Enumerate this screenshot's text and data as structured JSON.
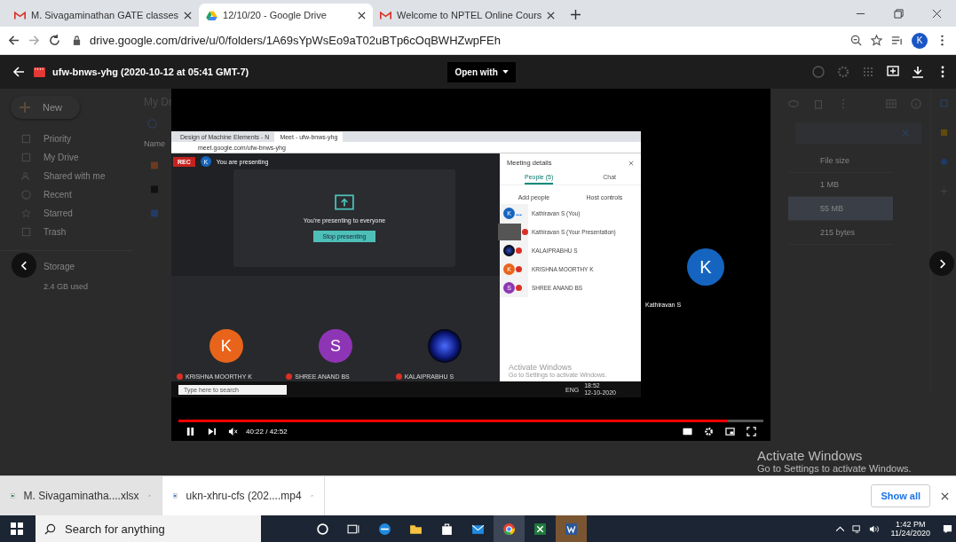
{
  "browser": {
    "tabs": [
      {
        "title": "M. Sivagaminathan GATE classes",
        "kind": "gmail",
        "selected": false
      },
      {
        "title": "12/10/20 - Google Drive",
        "kind": "drive",
        "selected": true
      },
      {
        "title": "Welcome to NPTEL Online Cours",
        "kind": "gmail",
        "selected": false
      }
    ],
    "url": "drive.google.com/drive/u/0/folders/1A69sYpWsEo9aT02uBTp6cOqBWHZwpFEh",
    "profile_initial": "K"
  },
  "viewer": {
    "file_name": "ufw-bnws-yhg (2020-10-12 at 05:41 GMT-7)",
    "open_with": "Open with"
  },
  "drive": {
    "new_button": "New",
    "nav": [
      {
        "label": "Priority",
        "kind": "priority"
      },
      {
        "label": "My Drive",
        "kind": "drive"
      },
      {
        "label": "Shared with me",
        "kind": "shared"
      },
      {
        "label": "Recent",
        "kind": "recent"
      },
      {
        "label": "Starred",
        "kind": "starred"
      },
      {
        "label": "Trash",
        "kind": "trash"
      }
    ],
    "storage_label": "Storage",
    "storage_used": "2.4 GB used",
    "breadcrumb": "My Dr",
    "name_header": "Name",
    "size_header": "File size",
    "files": [
      {
        "size": "1 MB",
        "kind": "slides",
        "selected": false
      },
      {
        "size": "55 MB",
        "kind": "video",
        "selected": true
      },
      {
        "size": "215 bytes",
        "kind": "doc",
        "selected": false
      }
    ]
  },
  "video": {
    "level": 0.94,
    "time": "40:22 / 42:52",
    "speaker": {
      "initial": "K",
      "name": "Kathiravan S",
      "color": "#1565c0"
    },
    "recording": {
      "tabs": [
        {
          "title": "Design of Machine Elements - N",
          "selected": false
        },
        {
          "title": "Meet - ufw-bnws-yhg",
          "selected": true
        }
      ],
      "url": "meet.google.com/ufw-bnws-yhg",
      "rec": "REC",
      "presenter_initial": "K",
      "status": "You are presenting",
      "message": "You're presenting to everyone",
      "stop": "Stop presenting",
      "tiles": [
        {
          "initial": "K",
          "kind": "avatar",
          "color": "#e8641b",
          "name": "KRISHNA MOORTHY K"
        },
        {
          "initial": "S",
          "kind": "avatar",
          "color": "#8e35b5",
          "name": "SHREE ANAND BS"
        },
        {
          "kind": "photo",
          "name": "KALAIPRABHU S"
        }
      ],
      "search": "Type here to search",
      "tray_lang": "ENG",
      "tray_time": "18:52",
      "tray_date": "12-10-2020",
      "panel": {
        "title": "Meeting details",
        "tabs": [
          {
            "label": "People (5)",
            "selected": true
          },
          {
            "label": "Chat",
            "selected": false
          }
        ],
        "actions": [
          "Add people",
          "Host controls"
        ],
        "people": [
          {
            "name": "Kathiravan S (You)",
            "kind": "avatar",
            "initial": "K",
            "color": "#1565c0",
            "muted": false
          },
          {
            "name": "Kathiravan S (Your Presentation)",
            "kind": "screen",
            "muted": true
          },
          {
            "name": "KALAIPRABHU S",
            "kind": "photo",
            "muted": true
          },
          {
            "name": "KRISHNA MOORTHY K",
            "kind": "avatar",
            "initial": "K",
            "color": "#e8641b",
            "muted": true
          },
          {
            "name": "SHREE ANAND BS",
            "kind": "avatar",
            "initial": "S",
            "color": "#8e35b5",
            "muted": true
          }
        ],
        "notice_title": "Activate Windows",
        "notice_text": "Go to Settings to activate Windows."
      }
    }
  },
  "downloads": {
    "items": [
      {
        "name": "M. Sivagaminatha....xlsx",
        "kind": "xlsx",
        "hovered": true
      },
      {
        "name": "ukn-xhru-cfs (202....mp4",
        "kind": "video",
        "hovered": false
      }
    ],
    "show_all": "Show all"
  },
  "activation": {
    "title": "Activate Windows",
    "text": "Go to Settings to activate Windows."
  },
  "taskbar": {
    "search": "Search for anything",
    "time": "1:42 PM",
    "date": "11/24/2020"
  }
}
